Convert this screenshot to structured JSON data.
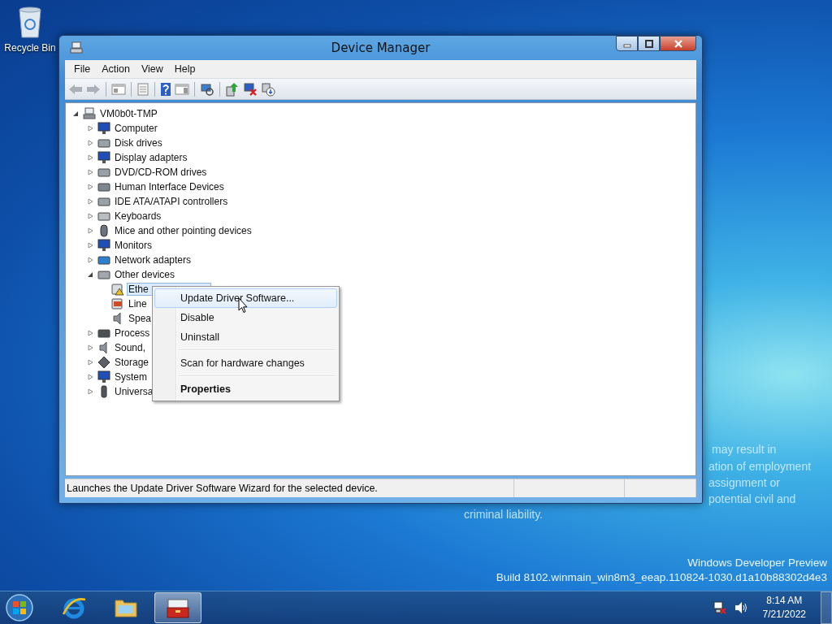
{
  "desktop_icons": [
    {
      "label": "Recycle Bin"
    }
  ],
  "desktop_notice": [
    "may result in",
    "ation of employment",
    "assignment or",
    "potential civil and",
    "criminal liability."
  ],
  "build_info": [
    "Windows Developer Preview",
    "Build 8102.winmain_win8m3_eeap.110824-1030.d1a10b88302d4e3"
  ],
  "window": {
    "title": "Device Manager",
    "menu": [
      "File",
      "Action",
      "View",
      "Help"
    ],
    "tree": {
      "label": "VM0b0t-TMP",
      "kind": "host",
      "expanded": true,
      "selected": false,
      "children": [
        {
          "label": "Computer",
          "kind": "monitor",
          "expanded": false,
          "selected": false
        },
        {
          "label": "Disk drives",
          "kind": "disk",
          "expanded": false,
          "selected": false
        },
        {
          "label": "Display adapters",
          "kind": "monitor",
          "expanded": false,
          "selected": false
        },
        {
          "label": "DVD/CD-ROM drives",
          "kind": "disk",
          "expanded": false,
          "selected": false
        },
        {
          "label": "Human Interface Devices",
          "kind": "hid",
          "expanded": false,
          "selected": false
        },
        {
          "label": "IDE ATA/ATAPI controllers",
          "kind": "disk",
          "expanded": false,
          "selected": false
        },
        {
          "label": "Keyboards",
          "kind": "keyboard",
          "expanded": false,
          "selected": false
        },
        {
          "label": "Mice and other pointing devices",
          "kind": "mouse",
          "expanded": false,
          "selected": false
        },
        {
          "label": "Monitors",
          "kind": "monitor",
          "expanded": false,
          "selected": false
        },
        {
          "label": "Network adapters",
          "kind": "network",
          "expanded": false,
          "selected": false
        },
        {
          "label": "Other devices",
          "kind": "unknown",
          "expanded": true,
          "selected": false,
          "children": [
            {
              "label": "Ethe",
              "kind": "warning",
              "selected": true
            },
            {
              "label": "Line",
              "kind": "modem",
              "selected": false
            },
            {
              "label": "Spea",
              "kind": "speaker",
              "selected": false
            }
          ]
        },
        {
          "label": "Process",
          "kind": "chip",
          "expanded": false,
          "selected": false
        },
        {
          "label": "Sound,",
          "kind": "speaker",
          "expanded": false,
          "selected": false
        },
        {
          "label": "Storage",
          "kind": "storage",
          "expanded": false,
          "selected": false
        },
        {
          "label": "System",
          "kind": "monitor",
          "expanded": false,
          "selected": false
        },
        {
          "label": "Universa",
          "kind": "usb",
          "expanded": false,
          "selected": false
        }
      ]
    },
    "status_bar": "Launches the Update Driver Software Wizard for the selected device."
  },
  "context_menu": [
    {
      "kind": "item",
      "label": "Update Driver Software...",
      "selected": true,
      "default": false
    },
    {
      "kind": "item",
      "label": "Disable",
      "selected": false,
      "default": false
    },
    {
      "kind": "item",
      "label": "Uninstall",
      "selected": false,
      "default": false
    },
    {
      "kind": "separator"
    },
    {
      "kind": "item",
      "label": "Scan for hardware changes",
      "selected": false,
      "default": false
    },
    {
      "kind": "separator"
    },
    {
      "kind": "item",
      "label": "Properties",
      "selected": false,
      "default": true
    }
  ],
  "taskbar": [
    {
      "kind": "browser",
      "selected": false
    },
    {
      "kind": "folder",
      "selected": false
    },
    {
      "kind": "toolbox",
      "selected": true
    }
  ],
  "clock": {
    "time": "8:14 AM",
    "date": "7/21/2022"
  }
}
